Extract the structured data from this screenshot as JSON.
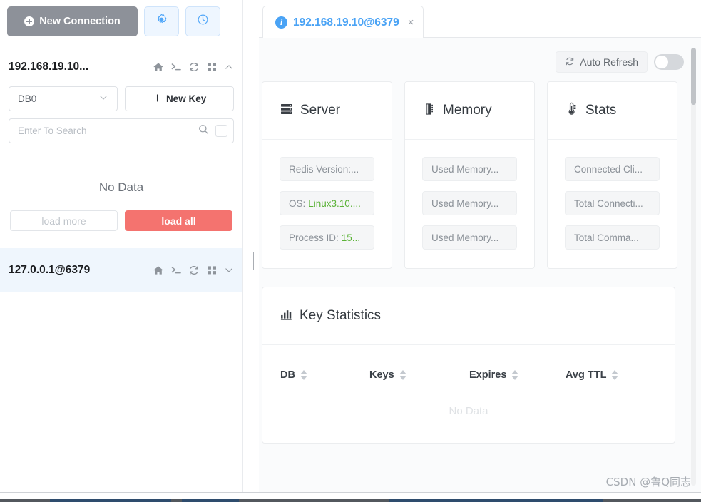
{
  "sidebar": {
    "new_connection_label": "New Connection",
    "settings_icon": "gear-icon",
    "history_icon": "clock-icon",
    "connection": {
      "name": "192.168.19.10...",
      "icons": [
        "home-icon",
        "terminal-icon",
        "refresh-icon",
        "grid-icon",
        "chevron-up-icon"
      ]
    },
    "db_select": {
      "value": "DB0"
    },
    "new_key_label": "New Key",
    "search": {
      "value": "",
      "placeholder": "Enter To Search"
    },
    "no_data_label": "No Data",
    "load_more_label": "load more",
    "load_all_label": "load all",
    "connection_selected": {
      "name": "127.0.0.1@6379",
      "icons": [
        "home-icon",
        "terminal-icon",
        "refresh-icon",
        "grid-icon",
        "chevron-down-icon"
      ]
    }
  },
  "main": {
    "tab": {
      "title": "192.168.19.10@6379",
      "close_label": "×",
      "badge_label": "i"
    },
    "auto_refresh": {
      "label": "Auto Refresh",
      "enabled": false
    },
    "cards": [
      {
        "title": "Server",
        "icon": "server-icon",
        "items": [
          {
            "label": "Redis Version:...",
            "value": ""
          },
          {
            "label": "OS:",
            "value": "Linux3.10...."
          },
          {
            "label": "Process ID:",
            "value": "15..."
          }
        ]
      },
      {
        "title": "Memory",
        "icon": "memory-chip-icon",
        "items": [
          {
            "label": "Used Memory...",
            "value": ""
          },
          {
            "label": "Used Memory...",
            "value": ""
          },
          {
            "label": "Used Memory...",
            "value": ""
          }
        ]
      },
      {
        "title": "Stats",
        "icon": "thermometer-icon",
        "items": [
          {
            "label": "Connected Cli...",
            "value": ""
          },
          {
            "label": "Total Connecti...",
            "value": ""
          },
          {
            "label": "Total Comma...",
            "value": ""
          }
        ]
      }
    ],
    "key_statistics": {
      "title": "Key Statistics",
      "icon": "bar-chart-icon",
      "columns": [
        "DB",
        "Keys",
        "Expires",
        "Avg TTL"
      ],
      "rows": [],
      "empty_label": "No Data"
    }
  },
  "watermark": "CSDN @鲁Q同志",
  "colors": {
    "accent_blue": "#4aa3f5",
    "danger_red": "#f4736f",
    "value_green": "#5cb338",
    "button_gray": "#8d9199"
  }
}
